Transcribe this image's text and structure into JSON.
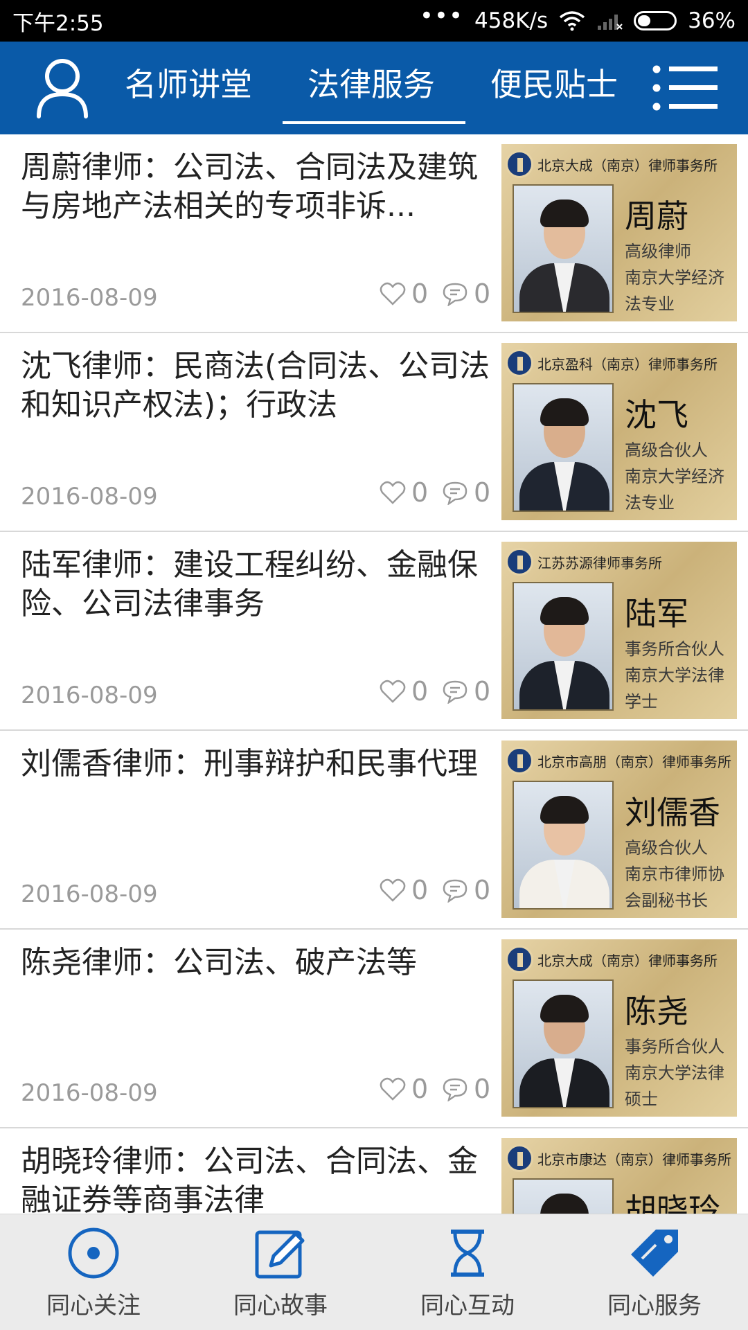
{
  "status_bar": {
    "time": "下午2:55",
    "dots": "•••",
    "speed": "458K/s",
    "battery": "36%",
    "battery_level": 0.36
  },
  "nav": {
    "tabs": [
      {
        "label": "名师讲堂",
        "active": false
      },
      {
        "label": "法律服务",
        "active": true
      },
      {
        "label": "便民贴士",
        "active": false
      }
    ],
    "user_icon": "user-icon",
    "menu_icon": "menu-icon"
  },
  "articles": [
    {
      "title": "周蔚律师：公司法、合同法及建筑与房地产法相关的专项非诉...",
      "date": "2016-08-09",
      "likes": "0",
      "comments": "0",
      "card": {
        "firm": "北京大成（南京）律师事务所",
        "name": "周蔚",
        "desc": [
          "高级律师",
          "南京大学经济",
          "法专业"
        ]
      }
    },
    {
      "title": "沈飞律师：民商法(合同法、公司法和知识产权法)；行政法",
      "date": "2016-08-09",
      "likes": "0",
      "comments": "0",
      "card": {
        "firm": "北京盈科（南京）律师事务所",
        "name": "沈飞",
        "desc": [
          "高级合伙人",
          "南京大学经济",
          "法专业"
        ]
      }
    },
    {
      "title": "陆军律师：建设工程纠纷、金融保险、公司法律事务",
      "date": "2016-08-09",
      "likes": "0",
      "comments": "0",
      "card": {
        "firm": "江苏苏源律师事务所",
        "name": "陆军",
        "desc": [
          "事务所合伙人",
          "南京大学法律",
          "学士"
        ]
      }
    },
    {
      "title": "刘儒香律师：刑事辩护和民事代理",
      "date": "2016-08-09",
      "likes": "0",
      "comments": "0",
      "card": {
        "firm": "北京市高朋（南京）律师事务所",
        "name": "刘儒香",
        "desc": [
          "高级合伙人",
          "南京市律师协",
          "会副秘书长"
        ]
      }
    },
    {
      "title": "陈尧律师：公司法、破产法等",
      "date": "2016-08-09",
      "likes": "0",
      "comments": "0",
      "card": {
        "firm": "北京大成（南京）律师事务所",
        "name": "陈尧",
        "desc": [
          "事务所合伙人",
          "南京大学法律",
          "硕士"
        ]
      }
    },
    {
      "title": "胡晓玲律师：公司法、合同法、金融证券等商事法律",
      "date": "",
      "likes": "",
      "comments": "",
      "card": {
        "firm": "北京市康达（南京）律师事务所",
        "name": "胡晓玲",
        "desc": []
      }
    }
  ],
  "bottom_nav": [
    {
      "label": "同心关注",
      "icon": "target-icon"
    },
    {
      "label": "同心故事",
      "icon": "edit-icon"
    },
    {
      "label": "同心互动",
      "icon": "hourglass-icon"
    },
    {
      "label": "同心服务",
      "icon": "tag-icon"
    }
  ],
  "colors": {
    "brand_blue": "#0a5aa8",
    "nav_icon_blue": "#1565c0",
    "meta_gray": "#9a9a9a"
  }
}
